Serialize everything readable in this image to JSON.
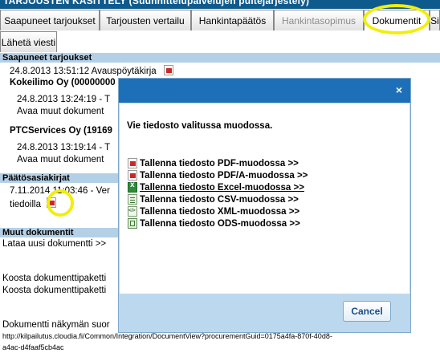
{
  "header": {
    "title": "TARJOUSTEN KÄSITTELY (Suunnittelupalvelujen puitejärjestely)"
  },
  "tabs": [
    {
      "label": "Saapuneet tarjoukset"
    },
    {
      "label": "Tarjousten vertailu"
    },
    {
      "label": "Hankintapäätös"
    },
    {
      "label": "Hankintasopimus"
    },
    {
      "label": "Dokumentit"
    },
    {
      "label": "Si"
    },
    {
      "label": "Lähetä viesti"
    }
  ],
  "sections": {
    "received": {
      "title": "Saapuneet tarjoukset",
      "line1": "24.8.2013 13:51:12  Avauspöytäkirja",
      "company1": "Kokeilimo Oy (00000000",
      "line2": "24.8.2013 13:24:19  -  T",
      "line3": "Avaa muut dokument",
      "company2": "PTCServices Oy (19169",
      "line4": "24.8.2013 13:19:14  -  T",
      "line5": "Avaa muut dokument"
    },
    "decisions": {
      "title": "Päätösasiakirjat",
      "line1": "7.11.2014 11:03:46  -  Ver",
      "line2": "tiedoilla"
    },
    "other": {
      "title": "Muut dokumentit",
      "line1": "Lataa uusi dokumentti >>",
      "line2": "Koosta dokumenttipaketti",
      "line3": "Koosta dokumenttipaketti",
      "line4": "Dokumentti näkymän suor",
      "url1": "http://kilpailutus.cloudia.fi/Common/Integration/DocumentView?procurementGuid=0175a4fa-870f-40d8-",
      "url2": "a4ac-d4faaf5cb4ac"
    }
  },
  "dialog": {
    "close_symbol": "×",
    "message": "Vie tiedosto valitussa muodossa.",
    "options": [
      {
        "label": "Tallenna tiedosto PDF-muodossa >>",
        "icon": "pdf-icon"
      },
      {
        "label": "Tallenna tiedosto PDF/A-muodossa >>",
        "icon": "pdf-icon"
      },
      {
        "label": "Tallenna tiedosto Excel-muodossa >>",
        "icon": "excel-icon"
      },
      {
        "label": "Tallenna tiedosto CSV-muodossa >>",
        "icon": "csv-icon"
      },
      {
        "label": "Tallenna tiedosto XML-muodossa >>",
        "icon": "xml-icon"
      },
      {
        "label": "Tallenna tiedosto ODS-muodossa >>",
        "icon": "ods-icon"
      }
    ],
    "cancel_label": "Cancel"
  },
  "colors": {
    "header_bg": "#0f5a8c",
    "section_bg": "#b4d0e6",
    "dialog_title_bg": "#1d70b7",
    "dialog_footer_bg": "#bcd8ee",
    "highlight_ring": "#f2ee0c"
  }
}
